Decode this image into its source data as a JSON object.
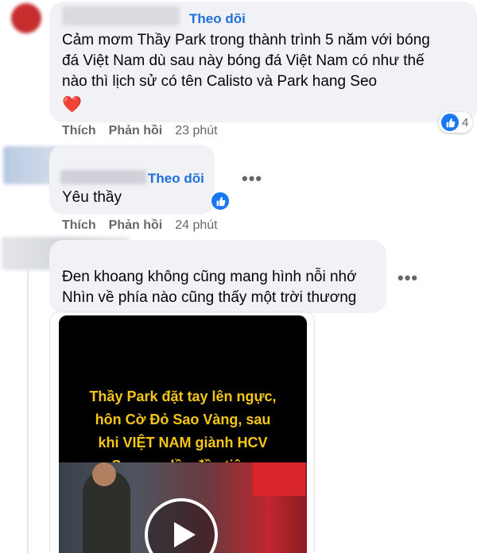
{
  "comments": [
    {
      "follow_label": "Theo dõi",
      "text": "Cảm mơm Thầy Park trong thành trình 5 năm với bóng đá Việt Nam dù sau này bóng đá Việt Nam có như thế nào thì lịch sử có tên Calisto và Park hang Seo",
      "line1": "Cảm mơm Thầy Park trong thành trình 5 năm với bóng",
      "line2": "đá Việt Nam dù sau này bóng đá Việt Nam có như thế",
      "line3": "nào thì lịch sử có tên Calisto và Park hang Seo",
      "emoji": "❤️",
      "like_label": "Thích",
      "reply_label": "Phản hồi",
      "time": "23 phút",
      "reaction_count": "4"
    },
    {
      "follow_label": "Theo dõi",
      "text": "Yêu thầy",
      "like_label": "Thích",
      "reply_label": "Phản hồi",
      "time": "24 phút"
    },
    {
      "line1": "Đen khoang không cũng mang hình nỗi nhớ",
      "line2": "Nhìn về phía nào cũng thấy một trời thương",
      "video": {
        "caption_line1": "Thầy Park đặt tay lên ngực,",
        "caption_line2": "hôn Cờ Đỏ Sao Vàng, sau",
        "caption_line3": "khi VIỆT NAM giành HCV",
        "caption_line4": "Segame lần đầu tiên."
      }
    }
  ],
  "more_icon": "more-options-icon",
  "colors": {
    "accent": "#216fdb",
    "bubble": "#f0f2f5",
    "like_blue": "#1877f2",
    "caption": "#f5c518"
  }
}
